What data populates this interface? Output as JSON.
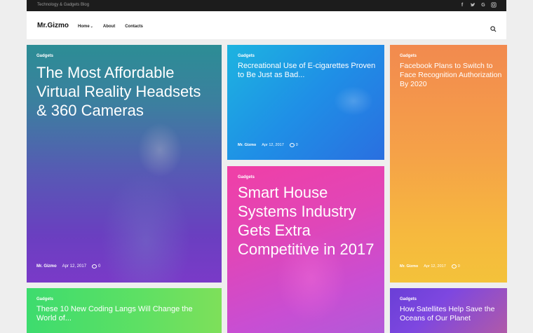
{
  "topbar": {
    "tagline": "Technology & Gadgets Blog",
    "socials": [
      "facebook-icon",
      "twitter-icon",
      "google-icon",
      "instagram-icon"
    ]
  },
  "nav": {
    "logo": "Mr.Gizmo",
    "items": [
      {
        "label": "Home",
        "has_dropdown": true
      },
      {
        "label": "About"
      },
      {
        "label": "Contacts"
      }
    ],
    "search_icon": "search-icon"
  },
  "posts": [
    {
      "category": "Gadgets",
      "title": "The Most Affordable Virtual Reality Headsets & 360 Cameras",
      "author": "Mr. Gizmo",
      "date": "Apr 12, 2017",
      "comments": "0",
      "color": "#5a4fbf"
    },
    {
      "category": "Gadgets",
      "title": "Recreational Use of E-cigarettes Proven to Be Just as Bad...",
      "author": "Mr. Gizmo",
      "date": "Apr 12, 2017",
      "comments": "0",
      "color": "#1f8fe6"
    },
    {
      "category": "Gadgets",
      "title": "Facebook Plans to Switch to Face Recognition Authorization By 2020",
      "author": "Mr. Gizmo",
      "date": "Apr 12, 2017",
      "comments": "0",
      "color": "#f5a148"
    },
    {
      "category": "Gadgets",
      "title": "Smart House Systems Industry Gets Extra Competitive in 2017",
      "color": "#e046b8"
    },
    {
      "category": "Gadgets",
      "title": "These 10 New Coding Langs Will Change the World of...",
      "color": "#5fe063"
    },
    {
      "category": "Gadgets",
      "title": "How Satellites Help Save the Oceans of Our Planet",
      "color": "#7e47e0"
    }
  ]
}
